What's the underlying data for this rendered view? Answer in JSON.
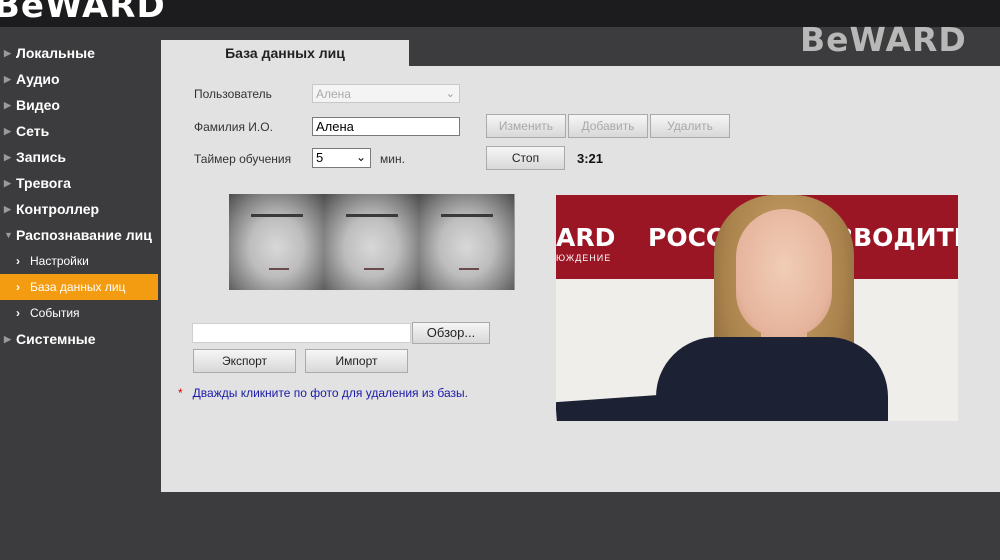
{
  "brand": {
    "logo_top": "BeWARD",
    "logo_right": "BeWARD"
  },
  "sidebar": {
    "items": [
      {
        "label": "Локальные"
      },
      {
        "label": "Аудио"
      },
      {
        "label": "Видео"
      },
      {
        "label": "Сеть"
      },
      {
        "label": "Запись"
      },
      {
        "label": "Тревога"
      },
      {
        "label": "Контроллер"
      },
      {
        "label": "Распознавание лиц"
      }
    ],
    "subitems": [
      {
        "label": "Настройки"
      },
      {
        "label": "База данных лиц"
      },
      {
        "label": "События"
      }
    ],
    "last": {
      "label": "Системные"
    },
    "active_color": "#f39c12"
  },
  "page": {
    "tab_title": "База данных лиц"
  },
  "form": {
    "user_label": "Пользователь",
    "user_select_value": "Алена",
    "name_label": "Фамилия И.О.",
    "name_value": "Алена",
    "timer_label": "Таймер обучения",
    "timer_value": "5",
    "timer_unit": "мин.",
    "buttons": {
      "edit": "Изменить",
      "add": "Добавить",
      "delete": "Удалить",
      "stop": "Стоп"
    },
    "countdown": "3:21"
  },
  "banner": {
    "left_text": "ARD",
    "left_small": "ЮЖДЕНИЕ",
    "right_text": "РОССИЙ   РОИЗВОДИТЕ"
  },
  "file": {
    "browse_label": "Обзор...",
    "export_label": "Экспорт",
    "import_label": "Импорт"
  },
  "note": {
    "star": "*",
    "text": "Дважды кликните по фото для удаления из базы."
  }
}
